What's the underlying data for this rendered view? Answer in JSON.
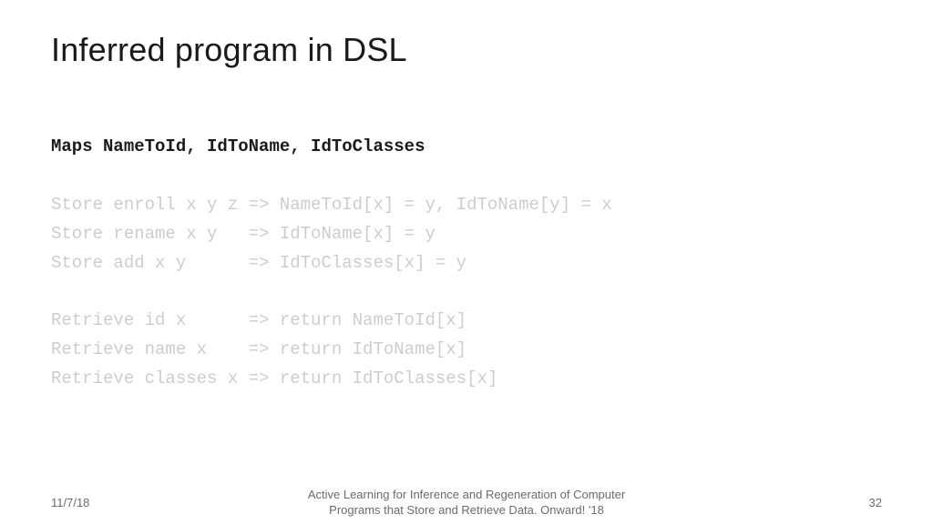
{
  "title": "Inferred program in DSL",
  "code": {
    "maps": "Maps NameToId, IdToName, IdToClasses",
    "store1": "Store enroll x y z => NameToId[x] = y, IdToName[y] = x",
    "store2": "Store rename x y   => IdToName[x] = y",
    "store3": "Store add x y      => IdToClasses[x] = y",
    "ret1": "Retrieve id x      => return NameToId[x]",
    "ret2": "Retrieve name x    => return IdToName[x]",
    "ret3": "Retrieve classes x => return IdToClasses[x]"
  },
  "footer": {
    "date": "11/7/18",
    "venue_line1": "Active Learning for Inference and Regeneration of Computer",
    "venue_line2": "Programs that Store and Retrieve Data. Onward! '18",
    "page": "32"
  }
}
